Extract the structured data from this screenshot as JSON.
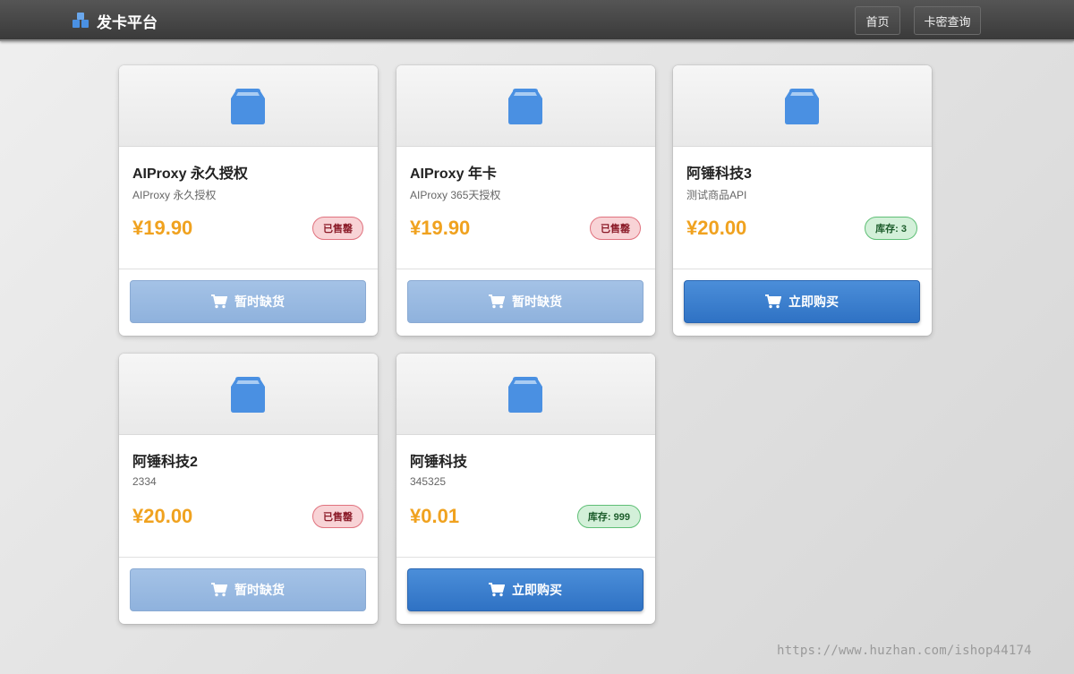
{
  "header": {
    "brand": "发卡平台",
    "nav": {
      "home": "首页",
      "query": "卡密查询"
    }
  },
  "colors": {
    "accent": "#3478c9",
    "price": "#f0a21f",
    "icon_blue": "#4a90e2"
  },
  "products": [
    {
      "name": "AIProxy 永久授权",
      "desc": "AIProxy 永久授权",
      "price": "¥19.90",
      "badge": "已售罄",
      "badge_type": "soldout",
      "button": "暂时缺货",
      "button_type": "disabled"
    },
    {
      "name": "AIProxy 年卡",
      "desc": "AIProxy 365天授权",
      "price": "¥19.90",
      "badge": "已售罄",
      "badge_type": "soldout",
      "button": "暂时缺货",
      "button_type": "disabled"
    },
    {
      "name": "阿锤科技3",
      "desc": "测试商品API",
      "price": "¥20.00",
      "badge": "库存: 3",
      "badge_type": "stock",
      "button": "立即购买",
      "button_type": "active"
    },
    {
      "name": "阿锤科技2",
      "desc": "2334",
      "price": "¥20.00",
      "badge": "已售罄",
      "badge_type": "soldout",
      "button": "暂时缺货",
      "button_type": "disabled"
    },
    {
      "name": "阿锤科技",
      "desc": "345325",
      "price": "¥0.01",
      "badge": "库存: 999",
      "badge_type": "stock",
      "button": "立即购买",
      "button_type": "active"
    }
  ],
  "watermark": "https://www.huzhan.com/ishop44174"
}
